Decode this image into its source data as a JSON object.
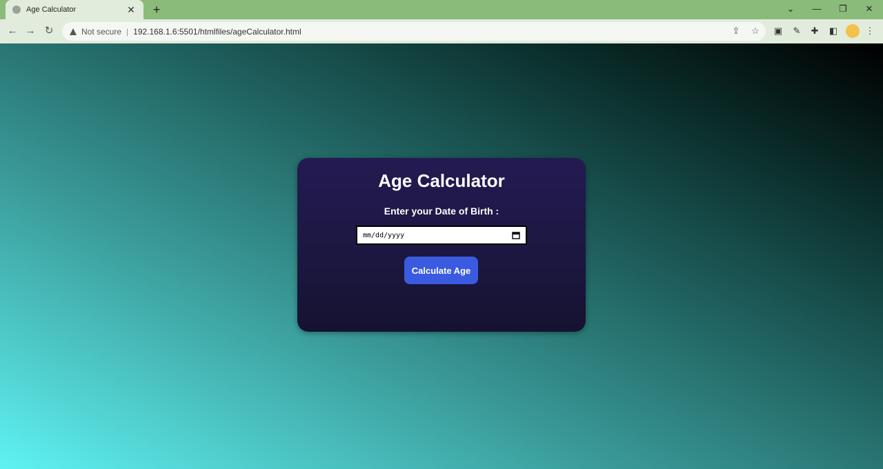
{
  "browser": {
    "tab_title": "Age Calculator",
    "tab_close": "✕",
    "new_tab": "+",
    "address": {
      "security_label": "Not secure",
      "url": "192.168.1.6:5501/htmlfiles/ageCalculator.html"
    },
    "window_controls": {
      "dropdown": "⌄",
      "minimize": "—",
      "restore": "❐",
      "close": "✕"
    }
  },
  "page": {
    "heading": "Age Calculator",
    "dob_label": "Enter your Date of Birth :",
    "date_input": {
      "placeholder": "mm/dd/yyyy",
      "value": "mm/dd/yyyy"
    },
    "calculate_button": "Calculate Age"
  },
  "colors": {
    "tabbar": "#8abb7a",
    "card_background": "#1f1a47",
    "button": "#3a5be0"
  },
  "icons": [
    "globe-icon",
    "back-icon",
    "forward-icon",
    "reload-icon",
    "warning-icon",
    "share-icon",
    "star-icon",
    "extension-icon",
    "pen-icon",
    "puzzle-icon",
    "sidebar-icon",
    "profile-avatar",
    "menu-icon",
    "calendar-icon"
  ]
}
